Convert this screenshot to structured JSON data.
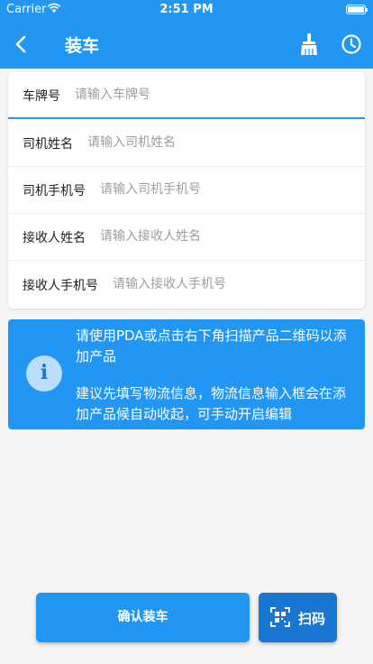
{
  "status_bar": {
    "carrier": "Carrier",
    "time": "2:51 PM"
  },
  "app_bar": {
    "title": "装车"
  },
  "form": {
    "fields": [
      {
        "label": "车牌号",
        "placeholder": "请输入车牌号",
        "value": ""
      },
      {
        "label": "司机姓名",
        "placeholder": "请输入司机姓名",
        "value": ""
      },
      {
        "label": "司机手机号",
        "placeholder": "请输入司机手机号",
        "value": ""
      },
      {
        "label": "接收人姓名",
        "placeholder": "请输入接收人姓名",
        "value": ""
      },
      {
        "label": "接收人手机号",
        "placeholder": "请输入接收人手机号",
        "value": ""
      }
    ]
  },
  "info": {
    "icon": "info-icon",
    "line1": "请使用PDA或点击右下角扫描产品二维码以添加产品",
    "line2": "建议先填写物流信息，物流信息输入框会在添加产品候自动收起，可手动开启编辑"
  },
  "actions": {
    "confirm_label": "确认装车",
    "scan_label": "扫码"
  },
  "colors": {
    "primary": "#2196f3",
    "primary_dark": "#1976d2",
    "background": "#f5f5f5"
  }
}
